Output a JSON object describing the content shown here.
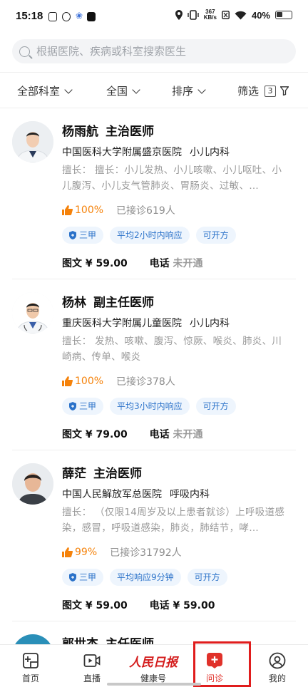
{
  "status_bar": {
    "time": "15:18",
    "speed_value": "367",
    "speed_unit": "KB/s",
    "battery": "40%"
  },
  "search": {
    "placeholder": "根据医院、疾病或科室搜索医生"
  },
  "filters": {
    "department": "全部科室",
    "region": "全国",
    "sort": "排序",
    "filter": "筛选",
    "filter_count": "3"
  },
  "doctors": [
    {
      "name": "杨雨航",
      "title": "主治医师",
      "hospital": "中国医科大学附属盛京医院",
      "department": "小儿内科",
      "skill": "擅长：  擅长：小儿发热、小儿咳嗽、小儿呕吐、小儿腹泻、小儿支气管肺炎、胃肠炎、过敏、…",
      "rating": "100%",
      "served": "已接诊619人",
      "tags": [
        "三甲",
        "平均2小时内响应",
        "可开方"
      ],
      "text_price": "图文 ¥ 59.00",
      "phone_label": "电话",
      "phone_price": "未开通"
    },
    {
      "name": "杨林",
      "title": "副主任医师",
      "hospital": "重庆医科大学附属儿童医院",
      "department": "小儿内科",
      "skill": "擅长：  发热、咳嗽、腹泻、惊厥、喉炎、肺炎、川崎病、传单、喉炎",
      "rating": "100%",
      "served": "已接诊378人",
      "tags": [
        "三甲",
        "平均3小时内响应",
        "可开方"
      ],
      "text_price": "图文 ¥ 79.00",
      "phone_label": "电话",
      "phone_price": "未开通"
    },
    {
      "name": "薛茫",
      "title": "主治医师",
      "hospital": "中国人民解放军总医院",
      "department": "呼吸内科",
      "skill": "擅长：  （仅限14周岁及以上患者就诊）上呼吸道感染，感冒，呼吸道感染，肺炎，肺结节，哮…",
      "rating": "99%",
      "served": "已接诊31792人",
      "tags": [
        "三甲",
        "平均响应9分钟",
        "可开方"
      ],
      "text_price": "图文 ¥ 59.00",
      "phone_label": "电话",
      "phone_price": "¥ 59.00"
    },
    {
      "name": "郭世杰",
      "title": "主任医师"
    }
  ],
  "nav": {
    "items": [
      {
        "label": "首页",
        "icon": "home-plus-icon"
      },
      {
        "label": "直播",
        "icon": "video-icon"
      },
      {
        "label": "健康号",
        "icon": "people-daily-logo"
      },
      {
        "label": "问诊",
        "icon": "consult-icon"
      },
      {
        "label": "我的",
        "icon": "user-icon"
      }
    ],
    "logo_text": "人民日报",
    "active_color": "#e0312a"
  },
  "colors": {
    "accent_orange": "#f5820a",
    "tag_blue": "#2b72c9",
    "tag_bg": "#eef5fd"
  }
}
